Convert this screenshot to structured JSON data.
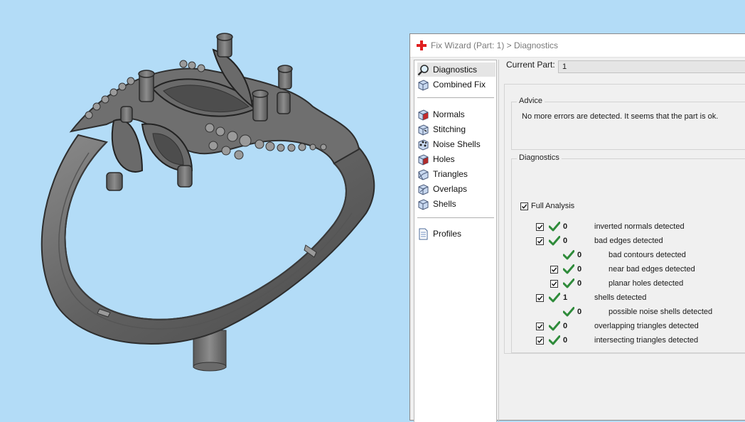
{
  "window": {
    "title": "Fix Wizard (Part: 1) > Diagnostics"
  },
  "nav": {
    "items": [
      {
        "label": "Diagnostics",
        "icon": "magnifier-icon",
        "selected": true
      },
      {
        "label": "Combined Fix",
        "icon": "cube-icon"
      },
      {
        "label": "Normals",
        "icon": "normals-cube-icon"
      },
      {
        "label": "Stitching",
        "icon": "stitching-cube-icon"
      },
      {
        "label": "Noise Shells",
        "icon": "noise-shells-cube-icon"
      },
      {
        "label": "Holes",
        "icon": "holes-cube-icon"
      },
      {
        "label": "Triangles",
        "icon": "triangles-cube-icon"
      },
      {
        "label": "Overlaps",
        "icon": "overlaps-cube-icon"
      },
      {
        "label": "Shells",
        "icon": "shells-cube-icon"
      },
      {
        "label": "Profiles",
        "icon": "document-icon"
      }
    ]
  },
  "current_part": {
    "label": "Current Part:",
    "value": "1"
  },
  "advice": {
    "legend": "Advice",
    "text": "No more errors are detected. It seems that the part is ok."
  },
  "diagnostics": {
    "legend": "Diagnostics",
    "full_analysis_label": "Full Analysis",
    "full_analysis_checked": true,
    "rows": [
      {
        "count": "0",
        "label": "inverted normals detected",
        "checkbox": true,
        "indent": 0
      },
      {
        "count": "0",
        "label": "bad edges detected",
        "checkbox": true,
        "indent": 0
      },
      {
        "count": "0",
        "label": "bad contours detected",
        "checkbox": false,
        "indent": 1
      },
      {
        "count": "0",
        "label": "near bad edges detected",
        "checkbox": true,
        "indent": 1
      },
      {
        "count": "0",
        "label": "planar holes detected",
        "checkbox": true,
        "indent": 1
      },
      {
        "count": "1",
        "label": "shells detected",
        "checkbox": true,
        "indent": 0
      },
      {
        "count": "0",
        "label": "possible noise shells detected",
        "checkbox": false,
        "indent": 1
      },
      {
        "count": "0",
        "label": "overlapping triangles detected",
        "checkbox": true,
        "indent": 0
      },
      {
        "count": "0",
        "label": "intersecting triangles detected",
        "checkbox": true,
        "indent": 0
      }
    ]
  },
  "colors": {
    "viewport_background": "#b3dcf7",
    "model_gray": "#6e6e6e",
    "check_green": "#2e8b3a",
    "title_icon_red": "#e02020"
  }
}
